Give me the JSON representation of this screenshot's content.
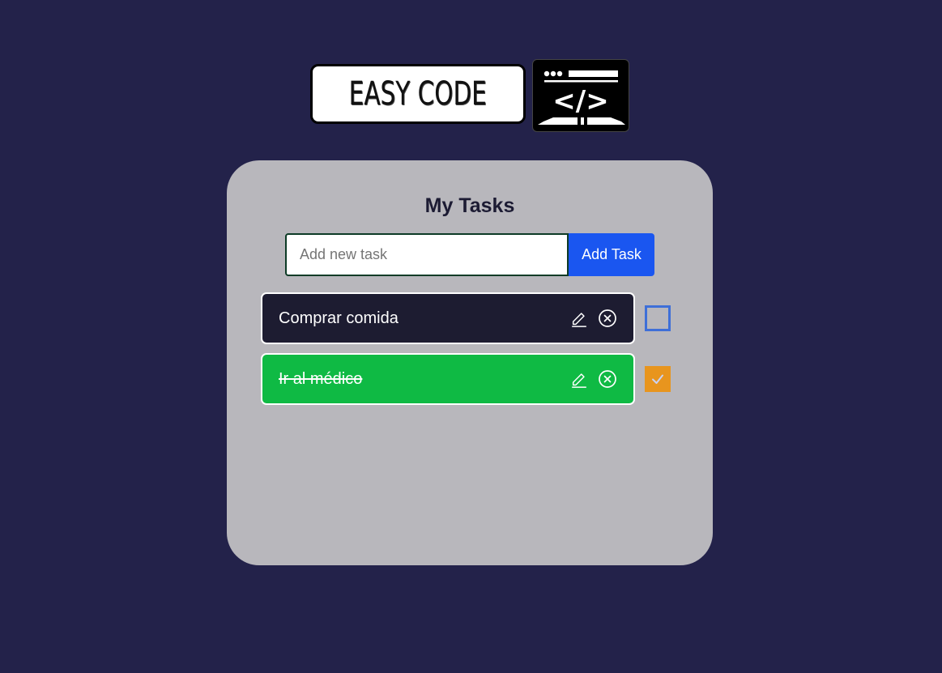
{
  "logo": {
    "text": "EASY CODE",
    "icon": "code-terminal-icon",
    "icon_glyph": "</>"
  },
  "app": {
    "title": "My Tasks",
    "input": {
      "placeholder": "Add new task",
      "value": ""
    },
    "add_button_label": "Add Task",
    "tasks": [
      {
        "text": "Comprar comida",
        "completed": false
      },
      {
        "text": "Ir al médico",
        "completed": true
      }
    ]
  },
  "colors": {
    "background": "#23224a",
    "card": "#b8b7bc",
    "pending_task": "#1d1c31",
    "done_task": "#0fba44",
    "add_button": "#1a56f0",
    "checkbox_border": "#3e6fd8",
    "checkbox_checked": "#e8951e"
  }
}
